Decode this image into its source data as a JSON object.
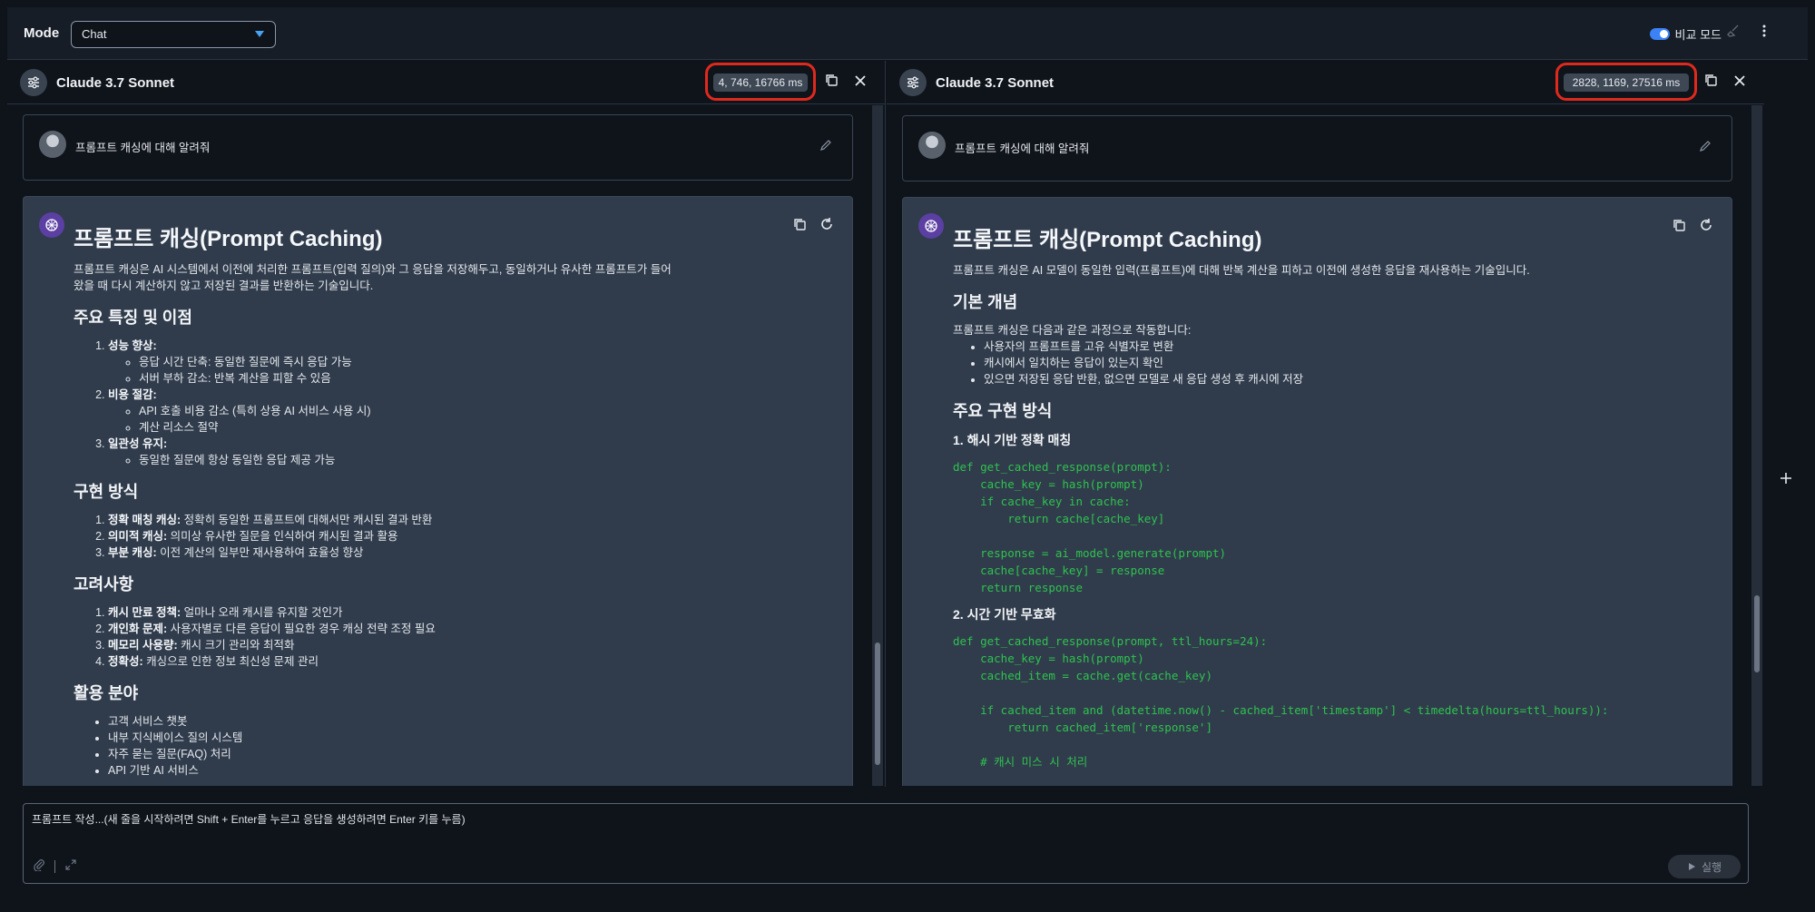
{
  "topbar": {
    "mode_label": "Mode",
    "mode_value": "Chat",
    "compare_label": "비교 모드",
    "compare_on": true
  },
  "composer": {
    "placeholder": "프롬프트 작성...(새 줄을 시작하려면 Shift + Enter를 누르고 응답을 생성하려면 Enter 키를 누름)",
    "run_label": "실행"
  },
  "panels": [
    {
      "model": "Claude 3.7 Sonnet",
      "metrics": "4, 746, 16766 ms",
      "user_prompt": "프롬프트 캐싱에 대해 알려줘",
      "title": "프롬프트 캐싱(Prompt Caching)",
      "intro": "프롬프트 캐싱은 AI 시스템에서 이전에 처리한 프롬프트(입력 질의)와 그 응답을 저장해두고, 동일하거나 유사한 프롬프트가 들어",
      "intro2": "왔을 때 다시 계산하지 않고 저장된 결과를 반환하는 기술입니다.",
      "s1": "주요 특징 및 이점",
      "s1_i1": "성능 향상:",
      "s1_i1a": "응답 시간 단축: 동일한 질문에 즉시 응답 가능",
      "s1_i1b": "서버 부하 감소: 반복 계산을 피할 수 있음",
      "s1_i2": "비용 절감:",
      "s1_i2a": "API 호출 비용 감소 (특히 상용 AI 서비스 사용 시)",
      "s1_i2b": "계산 리소스 절약",
      "s1_i3": "일관성 유지:",
      "s1_i3a": "동일한 질문에 항상 동일한 응답 제공 가능",
      "s2": "구현 방식",
      "s2_i1b": "정확 매칭 캐싱:",
      "s2_i1": " 정확히 동일한 프롬프트에 대해서만 캐시된 결과 반환",
      "s2_i2b": "의미적 캐싱:",
      "s2_i2": " 의미상 유사한 질문을 인식하여 캐시된 결과 활용",
      "s2_i3b": "부분 캐싱:",
      "s2_i3": " 이전 계산의 일부만 재사용하여 효율성 향상",
      "s3": "고려사항",
      "s3_i1b": "캐시 만료 정책:",
      "s3_i1": " 얼마나 오래 캐시를 유지할 것인가",
      "s3_i2b": "개인화 문제:",
      "s3_i2": " 사용자별로 다른 응답이 필요한 경우 캐싱 전략 조정 필요",
      "s3_i3b": "메모리 사용량:",
      "s3_i3": " 캐시 크기 관리와 최적화",
      "s3_i4b": "정확성:",
      "s3_i4": " 캐싱으로 인한 정보 최신성 문제 관리",
      "s4": "활용 분야",
      "s4_i1": "고객 서비스 챗봇",
      "s4_i2": "내부 지식베이스 질의 시스템",
      "s4_i3": "자주 묻는 질문(FAQ) 처리",
      "s4_i4": "API 기반 AI 서비스"
    },
    {
      "model": "Claude 3.7 Sonnet",
      "metrics": "2828, 1169, 27516 ms",
      "user_prompt": "프롬프트 캐싱에 대해 알려줘",
      "title": "프롬프트 캐싱(Prompt Caching)",
      "intro": "프롬프트 캐싱은 AI 모델이 동일한 입력(프롬프트)에 대해 반복 계산을 피하고 이전에 생성한 응답을 재사용하는 기술입니다.",
      "s1": "기본 개념",
      "s1_p": "프롬프트 캐싱은 다음과 같은 과정으로 작동합니다:",
      "s1_i1": "사용자의 프롬프트를 고유 식별자로 변환",
      "s1_i2": "캐시에서 일치하는 응답이 있는지 확인",
      "s1_i3": "있으면 저장된 응답 반환, 없으면 모델로 새 응답 생성 후 캐시에 저장",
      "s2": "주요 구현 방식",
      "s2_h1": "1. 해시 기반 정확 매칭",
      "code1": "def get_cached_response(prompt):\n    cache_key = hash(prompt)\n    if cache_key in cache:\n        return cache[cache_key]\n\n    response = ai_model.generate(prompt)\n    cache[cache_key] = response\n    return response",
      "s2_h2": "2. 시간 기반 무효화",
      "code2": "def get_cached_response(prompt, ttl_hours=24):\n    cache_key = hash(prompt)\n    cached_item = cache.get(cache_key)\n\n    if cached_item and (datetime.now() - cached_item['timestamp'] < timedelta(hours=ttl_hours)):\n        return cached_item['response']\n\n    # 캐시 미스 시 처리"
    }
  ]
}
